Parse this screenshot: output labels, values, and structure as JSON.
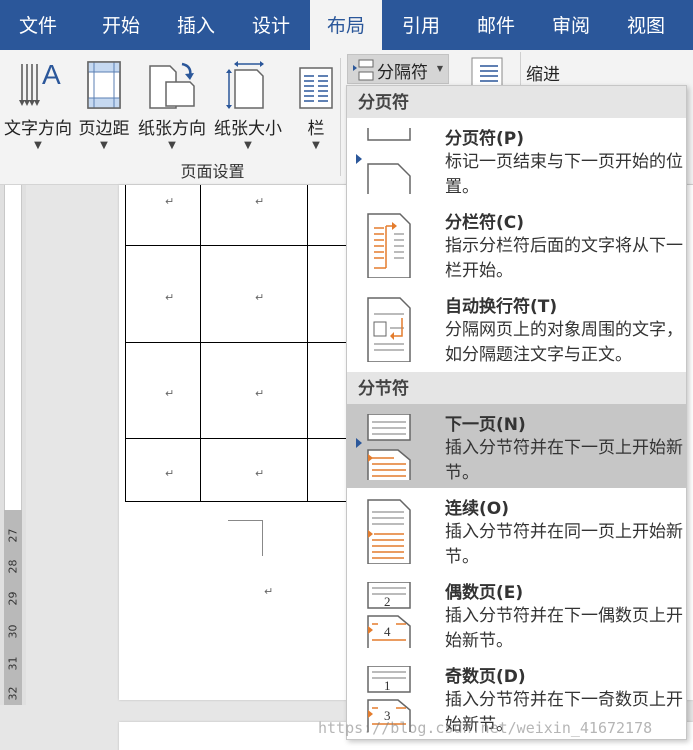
{
  "ribbon_tabs": [
    {
      "label": "文件",
      "active": false
    },
    {
      "label": "开始",
      "active": false
    },
    {
      "label": "插入",
      "active": false
    },
    {
      "label": "设计",
      "active": false
    },
    {
      "label": "布局",
      "active": true
    },
    {
      "label": "引用",
      "active": false
    },
    {
      "label": "邮件",
      "active": false
    },
    {
      "label": "审阅",
      "active": false
    },
    {
      "label": "视图",
      "active": false
    }
  ],
  "page_setup": {
    "buttons": [
      {
        "label": "文字方向",
        "icon": "text-direction-icon"
      },
      {
        "label": "页边距",
        "icon": "margins-icon"
      },
      {
        "label": "纸张方向",
        "icon": "orientation-icon"
      },
      {
        "label": "纸张大小",
        "icon": "paper-size-icon"
      },
      {
        "label": "栏",
        "icon": "columns-icon"
      }
    ],
    "group_label": "页面设置"
  },
  "breaks_button": {
    "label": "分隔符",
    "icon": "breaks-icon"
  },
  "indent_label": "缩进",
  "breaks_menu": {
    "sections": [
      {
        "header": "分页符",
        "items": [
          {
            "title": "分页符(P)",
            "description": "标记一页结束与下一页开始的位置。",
            "icon": "page-break-icon",
            "highlighted": false
          },
          {
            "title": "分栏符(C)",
            "description": "指示分栏符后面的文字将从下一栏开始。",
            "icon": "column-break-icon",
            "highlighted": false
          },
          {
            "title": "自动换行符(T)",
            "description": "分隔网页上的对象周围的文字，如分隔题注文字与正文。",
            "icon": "text-wrapping-break-icon",
            "highlighted": false
          }
        ]
      },
      {
        "header": "分节符",
        "items": [
          {
            "title": "下一页(N)",
            "description": "插入分节符并在下一页上开始新节。",
            "icon": "next-page-section-icon",
            "highlighted": true
          },
          {
            "title": "连续(O)",
            "description": "插入分节符并在同一页上开始新节。",
            "icon": "continuous-section-icon",
            "highlighted": false
          },
          {
            "title": "偶数页(E)",
            "description": "插入分节符并在下一偶数页上开始新节。",
            "icon": "even-page-section-icon",
            "highlighted": false,
            "icon_labels": [
              "2",
              "4"
            ]
          },
          {
            "title": "奇数页(D)",
            "description": "插入分节符并在下一奇数页上开始新节。",
            "icon": "odd-page-section-icon",
            "highlighted": false,
            "icon_labels": [
              "1",
              "3"
            ]
          }
        ]
      }
    ]
  },
  "ruler_numbers": [
    "27",
    "28",
    "29",
    "30",
    "31",
    "32"
  ],
  "paragraph_mark": "↵",
  "watermark": "https://blog.csdn.net/weixin_41672178"
}
